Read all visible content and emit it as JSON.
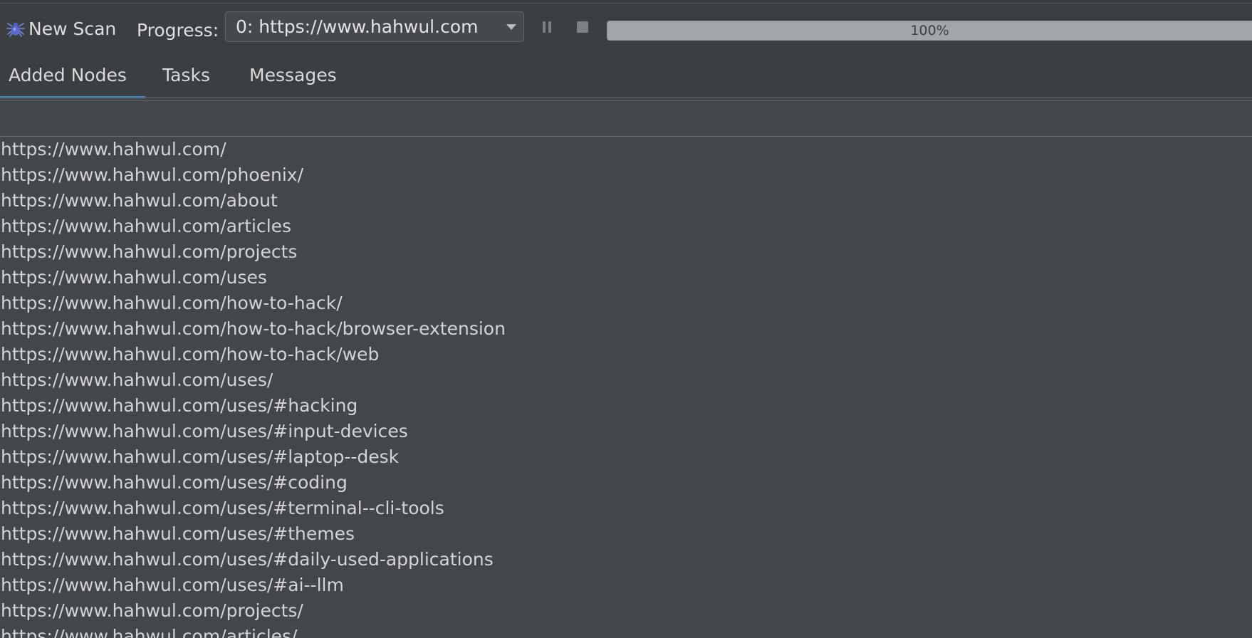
{
  "toolbar": {
    "new_scan_label": "New Scan",
    "new_scan_icon": "spider-icon",
    "progress_label": "Progress:",
    "scan_select_value": "0: https://www.hahwul.com",
    "pause_icon": "pause-icon",
    "stop_icon": "stop-icon",
    "progress_percent": 100,
    "progress_text": "100%"
  },
  "tabs": [
    {
      "label": "Added Nodes",
      "active": true
    },
    {
      "label": "Tasks",
      "active": false
    },
    {
      "label": "Messages",
      "active": false
    }
  ],
  "colors": {
    "accent": "#4a88c7",
    "background": "#43474b",
    "toolbar": "#3c3f42"
  },
  "added_nodes": [
    "https://www.hahwul.com/",
    "https://www.hahwul.com/phoenix/",
    "https://www.hahwul.com/about",
    "https://www.hahwul.com/articles",
    "https://www.hahwul.com/projects",
    "https://www.hahwul.com/uses",
    "https://www.hahwul.com/how-to-hack/",
    "https://www.hahwul.com/how-to-hack/browser-extension",
    "https://www.hahwul.com/how-to-hack/web",
    "https://www.hahwul.com/uses/",
    "https://www.hahwul.com/uses/#hacking",
    "https://www.hahwul.com/uses/#input-devices",
    "https://www.hahwul.com/uses/#laptop--desk",
    "https://www.hahwul.com/uses/#coding",
    "https://www.hahwul.com/uses/#terminal--cli-tools",
    "https://www.hahwul.com/uses/#themes",
    "https://www.hahwul.com/uses/#daily-used-applications",
    "https://www.hahwul.com/uses/#ai--llm",
    "https://www.hahwul.com/projects/",
    "https://www.hahwul.com/articles/"
  ]
}
